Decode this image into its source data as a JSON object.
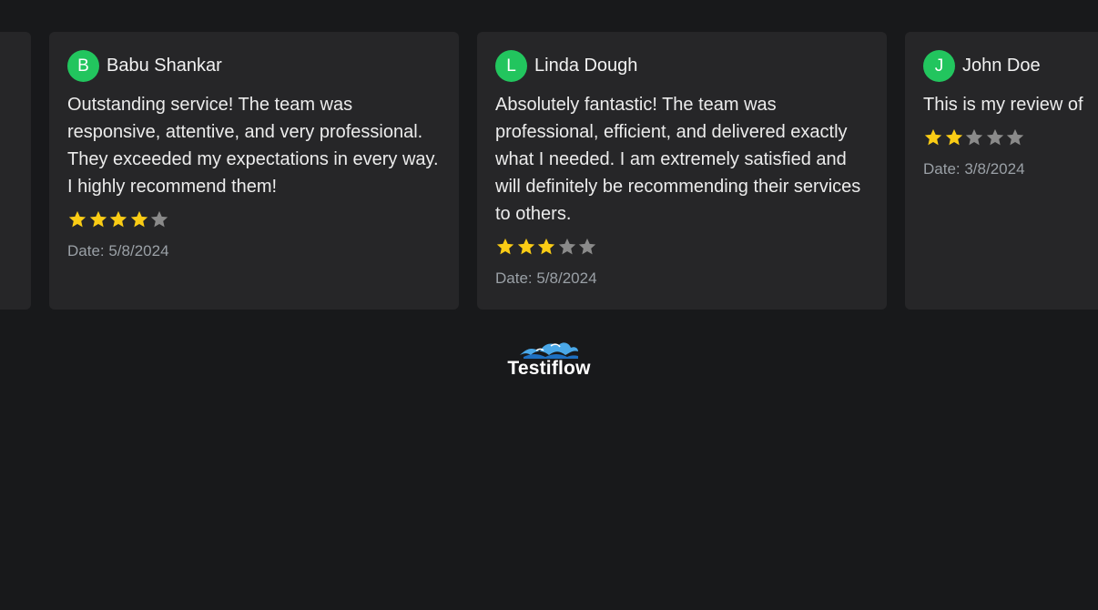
{
  "colors": {
    "background": "#18191b",
    "card": "#262628",
    "avatar": "#22c55e",
    "star_filled": "#facc15",
    "star_empty": "#8a8a8a",
    "date_text": "#9aa0a6"
  },
  "reviews": [
    {
      "initial": "",
      "name": "",
      "text": "",
      "rating": 0,
      "date": ""
    },
    {
      "initial": "B",
      "name": "Babu Shankar",
      "text": "Outstanding service! The team was responsive, attentive, and very professional. They exceeded my expectations in every way. I highly recommend them!",
      "rating": 4,
      "date": "Date: 5/8/2024"
    },
    {
      "initial": "L",
      "name": "Linda Dough",
      "text": "Absolutely fantastic! The team was professional, efficient, and delivered exactly what I needed. I am extremely satisfied and will definitely be recommending their services to others.",
      "rating": 3,
      "date": "Date: 5/8/2024"
    },
    {
      "initial": "J",
      "name": "John Doe",
      "text": "This is my review of",
      "rating": 2,
      "date": "Date: 3/8/2024"
    }
  ],
  "brand": {
    "logo_icon": "wave-icon",
    "name": "Testiflow"
  }
}
